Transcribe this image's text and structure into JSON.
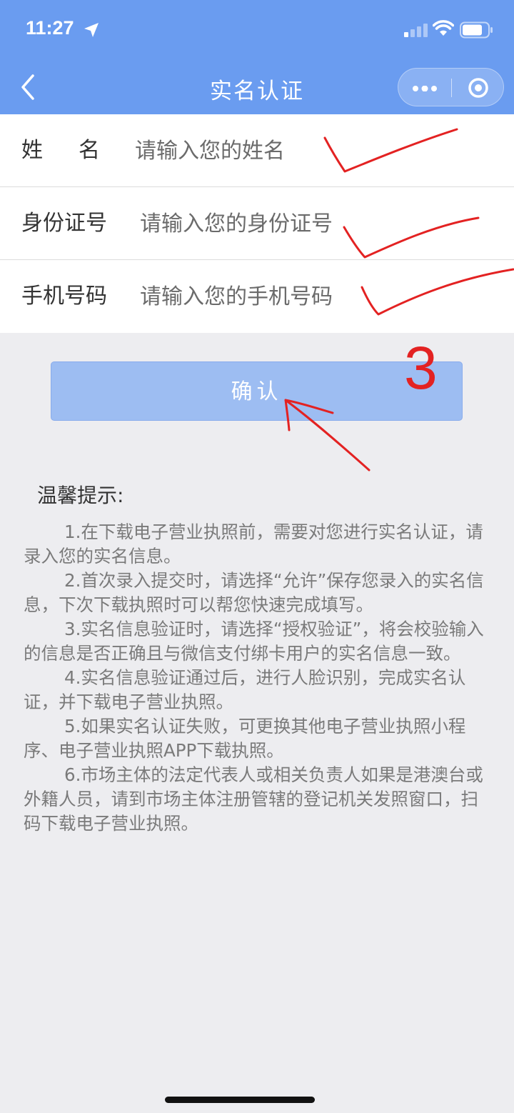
{
  "status_bar": {
    "time": "11:27"
  },
  "nav": {
    "title": "实名认证"
  },
  "form": {
    "name": {
      "label": "姓名",
      "placeholder": "请输入您的姓名"
    },
    "id_number": {
      "label": "身份证号",
      "placeholder": "请输入您的身份证号"
    },
    "phone": {
      "label": "手机号码",
      "placeholder": "请输入您的手机号码"
    }
  },
  "confirm_label": "确认",
  "annotation": {
    "step_number": "3",
    "color": "#e32222"
  },
  "tips": {
    "title": "温馨提示:",
    "items": [
      "1.在下载电子营业执照前，需要对您进行实名认证，请录入您的实名信息。",
      "2.首次录入提交时，请选择“允许”保存您录入的实名信息，下次下载执照时可以帮您快速完成填写。",
      "3.实名信息验证时，请选择“授权验证”，将会校验输入的信息是否正确且与微信支付绑卡用户的实名信息一致。",
      "4.实名信息验证通过后，进行人脸识别，完成实名认证，并下载电子营业执照。",
      "5.如果实名认证失败，可更换其他电子营业执照小程序、电子营业执照APP下载执照。",
      "6.市场主体的法定代表人或相关负责人如果是港澳台或外籍人员，请到市场主体注册管辖的登记机关发照窗口，扫码下载电子营业执照。"
    ]
  },
  "colors": {
    "header": "#6a9cf0",
    "button": "#9dbdf2",
    "background": "#ededf0"
  }
}
